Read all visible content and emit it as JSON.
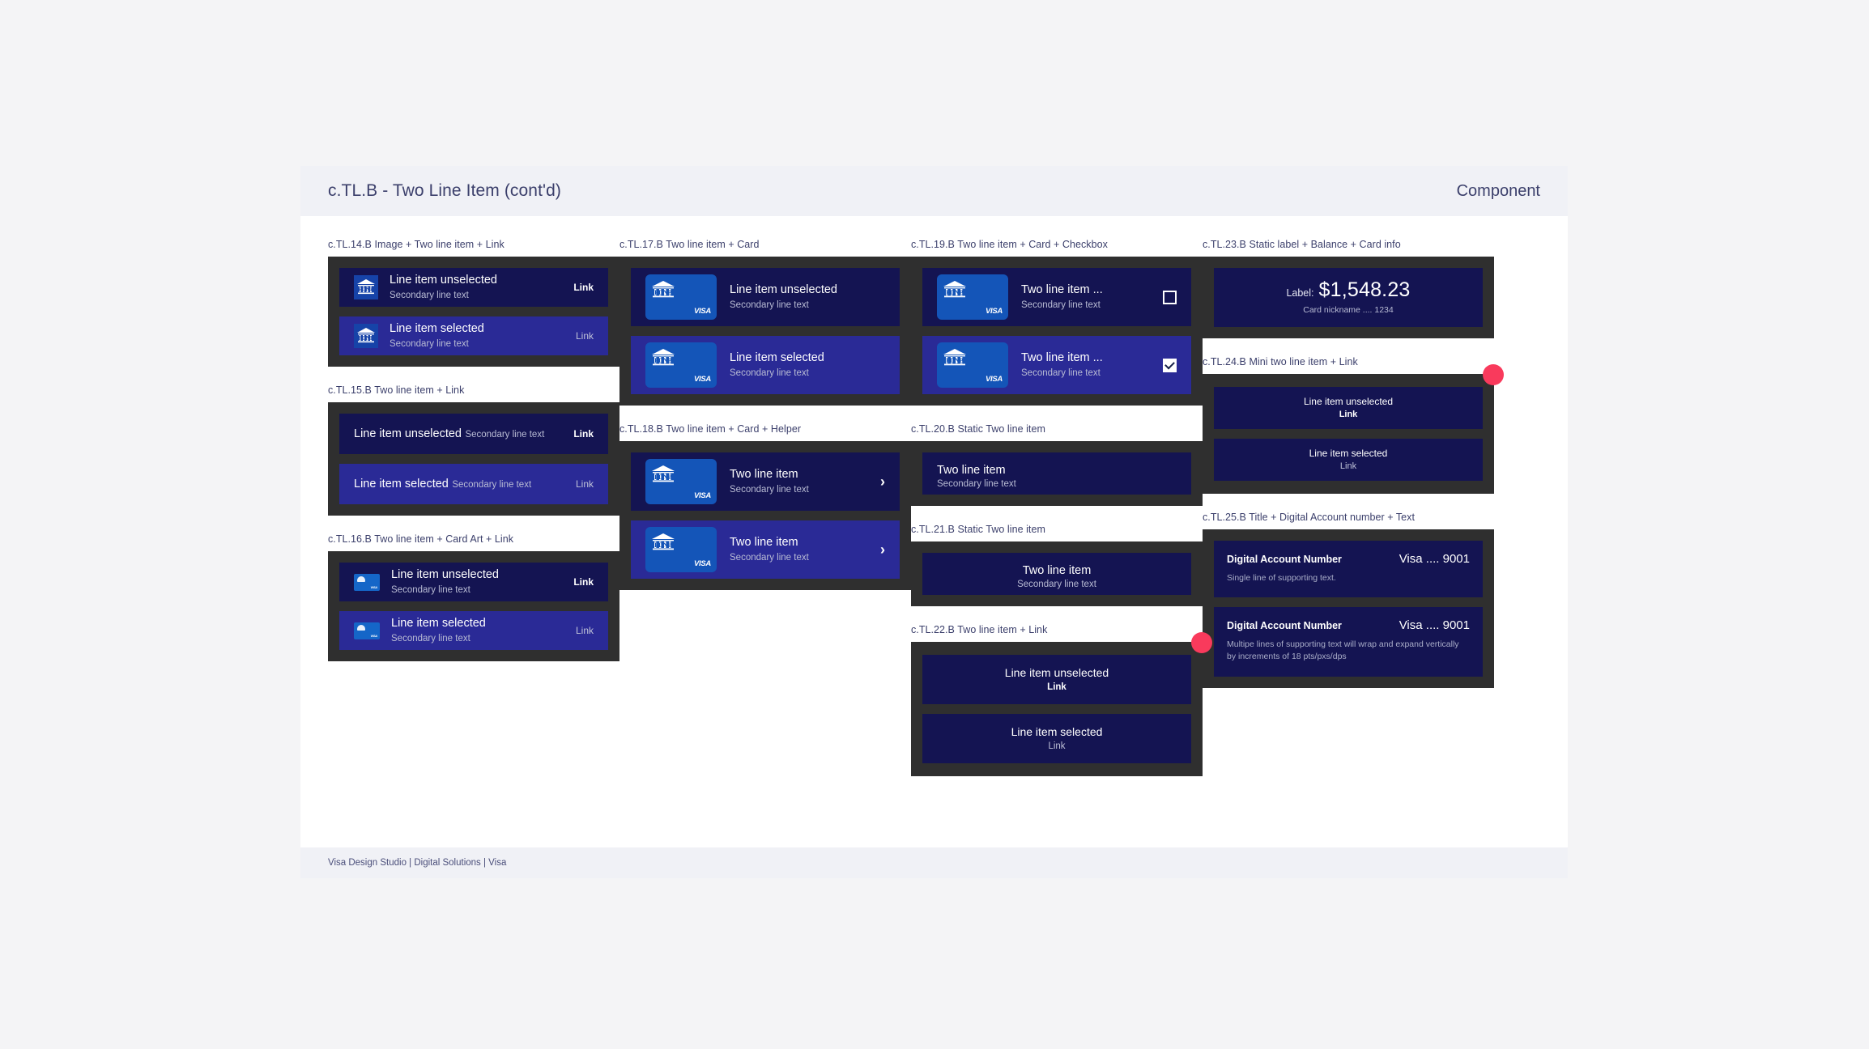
{
  "header": {
    "title": "c.TL.B - Two Line Item (cont'd)",
    "kind": "Component"
  },
  "footer": {
    "text": "Visa Design Studio | Digital Solutions | Visa"
  },
  "common": {
    "secondary_line": "Secondary line text",
    "link": "Link",
    "visa_mark": "VISA",
    "visa_mini": "VISA",
    "fdnb": "FDNB",
    "chevron": "›"
  },
  "colors": {
    "page_bg": "#F4F4F6",
    "sheet_bg": "#FFFFFF",
    "header_bg": "#F0F1F6",
    "header_text": "#3B3F6B",
    "frame_bg": "#2F2F2F",
    "row_unselected": "#141452",
    "row_selected": "#2A2A96",
    "card_blue": "#1455B8",
    "marker_red": "#F93A5C",
    "secondary_text": "#B9BCD4"
  },
  "specs": {
    "tl14": {
      "label": "c.TL.14.B Image + Two line item + Link",
      "rows": [
        {
          "primary": "Line item unselected",
          "secondary": "Secondary line text",
          "link": "Link",
          "state": "unselected"
        },
        {
          "primary": "Line item selected",
          "secondary": "Secondary line text",
          "link": "Link",
          "state": "selected"
        }
      ]
    },
    "tl15": {
      "label": "c.TL.15.B Two line item + Link",
      "rows": [
        {
          "primary": "Line item unselected",
          "secondary": "Secondary line text",
          "link": "Link",
          "state": "unselected"
        },
        {
          "primary": "Line item selected",
          "secondary": "Secondary line text",
          "link": "Link",
          "state": "selected"
        }
      ]
    },
    "tl16": {
      "label": "c.TL.16.B Two line item + Card Art + Link",
      "rows": [
        {
          "primary": "Line item unselected",
          "secondary": "Secondary line text",
          "link": "Link",
          "state": "unselected"
        },
        {
          "primary": "Line item selected",
          "secondary": "Secondary line text",
          "link": "Link",
          "state": "selected"
        }
      ]
    },
    "tl17": {
      "label": "c.TL.17.B Two line item + Card",
      "rows": [
        {
          "primary": "Line item unselected",
          "secondary": "Secondary line text",
          "state": "unselected"
        },
        {
          "primary": "Line item selected",
          "secondary": "Secondary line text",
          "state": "selected"
        }
      ]
    },
    "tl18": {
      "label": "c.TL.18.B Two line item + Card + Helper",
      "rows": [
        {
          "primary": "Two line item",
          "secondary": "Secondary line text",
          "state": "unselected"
        },
        {
          "primary": "Two line item",
          "secondary": "Secondary line text",
          "state": "selected"
        }
      ]
    },
    "tl19": {
      "label": "c.TL.19.B Two line item + Card + Checkbox",
      "rows": [
        {
          "primary": "Two line item ...",
          "secondary": "Secondary line text",
          "checked": false,
          "state": "unselected"
        },
        {
          "primary": "Two line item ...",
          "secondary": "Secondary line text",
          "checked": true,
          "state": "selected"
        }
      ]
    },
    "tl20": {
      "label": "c.TL.20.B Static Two line item",
      "primary": "Two line item",
      "secondary": "Secondary line text"
    },
    "tl21": {
      "label": "c.TL.21.B Static Two line item",
      "primary": "Two line item",
      "secondary": "Secondary line text"
    },
    "tl22": {
      "label": "c.TL.22.B Two line item + Link",
      "rows": [
        {
          "primary": "Line item unselected",
          "link": "Link",
          "state": "unselected"
        },
        {
          "primary": "Line item selected",
          "link": "Link",
          "state": "selected"
        }
      ]
    },
    "tl23": {
      "label": "c.TL.23.B Static label + Balance + Card info",
      "balance_label": "Label:",
      "balance_amount": "$1,548.23",
      "card_info": "Card nickname .... 1234"
    },
    "tl24": {
      "label": "c.TL.24.B Mini two line item + Link",
      "rows": [
        {
          "primary": "Line item unselected",
          "link": "Link",
          "state": "unselected"
        },
        {
          "primary": "Line item selected",
          "link": "Link",
          "state": "selected"
        }
      ]
    },
    "tl25": {
      "label": "c.TL.25.B Title + Digital Account number + Text",
      "rows": [
        {
          "title": "Digital Account Number",
          "value": "Visa .... 9001",
          "support": "Single line of supporting text."
        },
        {
          "title": "Digital Account Number",
          "value": "Visa .... 9001",
          "support": "Multipe lines of supporting text will wrap and expand vertically by increments of 18 pts/pxs/dps"
        }
      ]
    }
  }
}
